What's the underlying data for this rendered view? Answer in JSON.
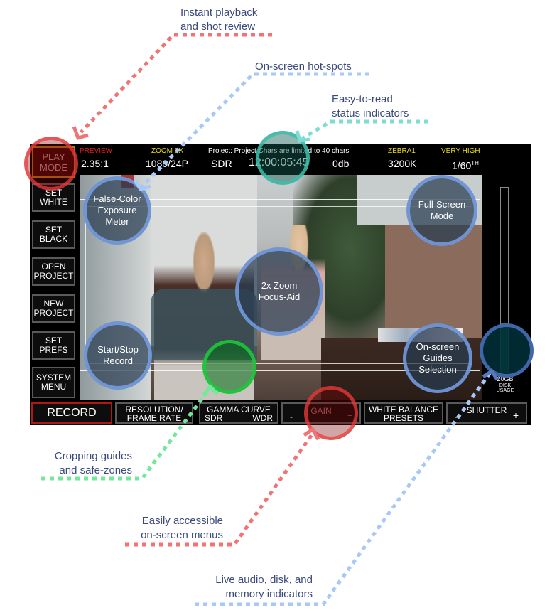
{
  "annotations": {
    "playback": "Instant playback\nand shot review",
    "hotspots": "On-screen hot-spots",
    "status": "Easy-to-read\nstatus indicators",
    "cropping": "Cropping guides\nand safe-zones",
    "menus": "Easily accessible\non-screen menus",
    "indicators": "Live audio, disk, and\nmemory indicators"
  },
  "colors": {
    "annotation_text": "#3a4a7e",
    "leader_red": "#f07474",
    "leader_blue": "#a8c8f8",
    "leader_teal": "#7fdcd2",
    "leader_green": "#74e89a",
    "label_yellow": "#e6d820",
    "label_red": "#e21c1c",
    "disk_fill": "#0c7a4a"
  },
  "status_bar": {
    "preview_label": "PREVIEW",
    "aspect": "2.35:1",
    "zoom_label": "ZOOM 2X",
    "resolution": "1080/24P",
    "project": "Project: Project Chars are limited to 40 chars",
    "gamma": "SDR",
    "timecode": "12:00:05:45",
    "gain": "0db",
    "zebra_label": "ZEBRA1",
    "white_balance": "3200K",
    "quality_label": "VERY HIGH",
    "shutter": "1/60",
    "shutter_suffix": "TH"
  },
  "side_menu": [
    {
      "label": "PLAY\nMODE"
    },
    {
      "label": "SET\nWHITE"
    },
    {
      "label": "SET\nBLACK"
    },
    {
      "label": "OPEN\nPROJECT"
    },
    {
      "label": "NEW\nPROJECT"
    },
    {
      "label": "SET\nPREFS"
    },
    {
      "label": "SYSTEM\nMENU"
    }
  ],
  "bottom_menu": {
    "record": "RECORD",
    "resolution_line1": "RESOLUTION/",
    "resolution_line2": "FRAME RATE",
    "gamma_title": "GAMMA CURVE",
    "gamma_left": "SDR",
    "gamma_right": "WDR",
    "gain_title": "GAIN",
    "gain_minus": "-",
    "gain_plus": "+",
    "wb_line1": "WHITE BALANCE",
    "wb_line2": "PRESETS",
    "shutter_title": "SHUTTER",
    "shutter_minus": "-",
    "shutter_plus": "+"
  },
  "disk": {
    "amount": "20GB",
    "label_line1": "DISK",
    "label_line2": "USAGE",
    "fill_fraction": 0.27
  },
  "hotspots": {
    "false_color": "False-Color\nExposure\nMeter",
    "full_screen": "Full-Screen\nMode",
    "zoom_focus": "2x Zoom\nFocus-Aid",
    "start_stop": "Start/Stop\nRecord",
    "guides": "On-screen\nGuides\nSelection"
  }
}
